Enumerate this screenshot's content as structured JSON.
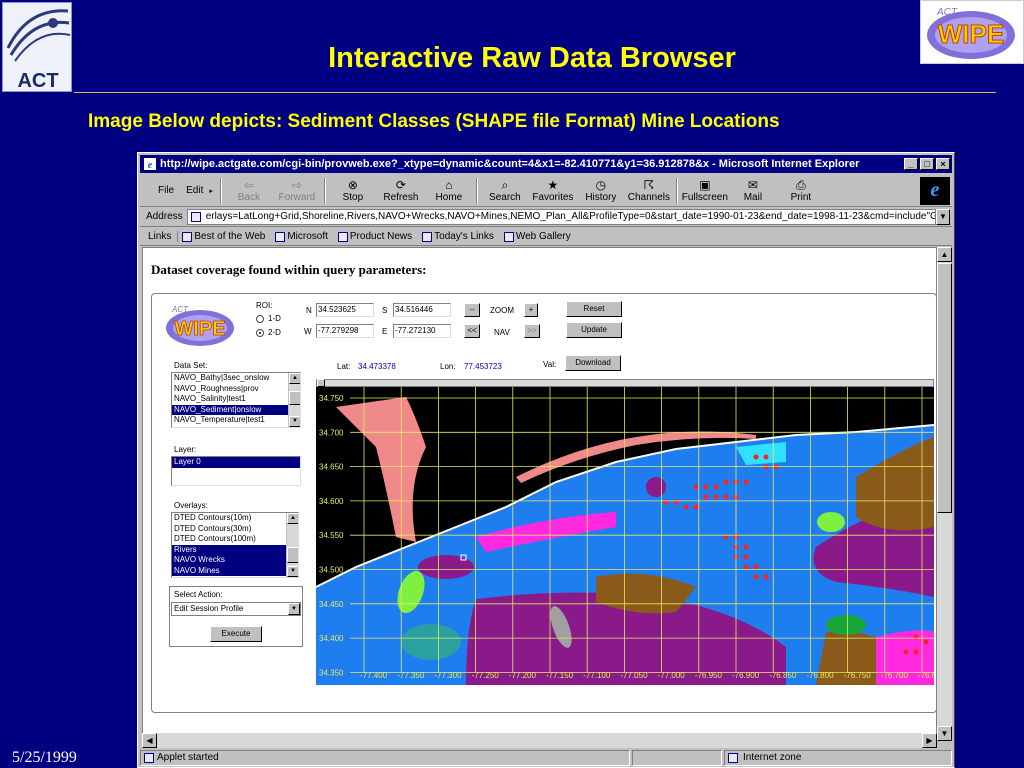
{
  "slide": {
    "title": "Interactive Raw Data Browser",
    "subtitle": "Image Below depicts: Sediment Classes (SHAPE file Format) Mine Locations",
    "date": "5/25/1999",
    "logo_left": "ACT",
    "logo_right": "WIPE"
  },
  "browser": {
    "title": "http://wipe.actgate.com/cgi-bin/provweb.exe?_xtype=dynamic&count=4&x1=-82.410771&y1=36.912878&x - Microsoft Internet Explorer",
    "menus": [
      "File",
      "Edit"
    ],
    "toolbar": [
      {
        "label": "Back",
        "icon": "back-arrow-icon",
        "glyph": "⇦",
        "enabled": false
      },
      {
        "label": "Forward",
        "icon": "forward-arrow-icon",
        "glyph": "⇨",
        "enabled": false
      },
      {
        "label": "Stop",
        "icon": "stop-icon",
        "glyph": "⊗",
        "enabled": true
      },
      {
        "label": "Refresh",
        "icon": "refresh-icon",
        "glyph": "⟳",
        "enabled": true
      },
      {
        "label": "Home",
        "icon": "home-icon",
        "glyph": "⌂",
        "enabled": true
      },
      {
        "label": "Search",
        "icon": "search-icon",
        "glyph": "⌕",
        "enabled": true
      },
      {
        "label": "Favorites",
        "icon": "favorites-icon",
        "glyph": "★",
        "enabled": true
      },
      {
        "label": "History",
        "icon": "history-icon",
        "glyph": "◷",
        "enabled": true
      },
      {
        "label": "Channels",
        "icon": "channels-icon",
        "glyph": "☈",
        "enabled": true
      },
      {
        "label": "Fullscreen",
        "icon": "fullscreen-icon",
        "glyph": "▣",
        "enabled": true
      },
      {
        "label": "Mail",
        "icon": "mail-icon",
        "glyph": "✉",
        "enabled": true
      },
      {
        "label": "Print",
        "icon": "print-icon",
        "glyph": "⎙",
        "enabled": true
      }
    ],
    "address_label": "Address",
    "address_value": "erlays=LatLong+Grid,Shoreline,Rivers,NAVO+Wrecks,NAVO+Mines,NEMO_Plan_All&ProfileType=0&start_date=1990-01-23&end_date=1998-11-23&cmd=include\"Get_Data.msh\"\\n",
    "links_label": "Links",
    "links": [
      "Best of the Web",
      "Microsoft",
      "Product News",
      "Today's Links",
      "Web Gallery"
    ],
    "status_text": "Applet started",
    "zone_text": "Internet zone"
  },
  "page": {
    "heading": "Dataset coverage found within query parameters:"
  },
  "applet": {
    "logo": "WIPE",
    "roi_label": "ROI:",
    "roi_options": [
      "1-D",
      "2-D"
    ],
    "roi_selected": "2-D",
    "n_label": "N",
    "n_value": "34.523625",
    "s_label": "S",
    "s_value": "34.516446",
    "w_label": "W",
    "w_value": "-77.279298",
    "e_label": "E",
    "e_value": "-77.272130",
    "zoom_label": "ZOOM",
    "nav_label": "NAV",
    "zoom_out": "--",
    "zoom_in": "+",
    "nav_left": "<<",
    "nav_right": ">>",
    "reset": "Reset",
    "update": "Update",
    "lat_label": "Lat:",
    "lat_value": "34.473378",
    "lon_label": "Lon:",
    "lon_value": "77.453723",
    "val_label": "Val:",
    "download": "Download",
    "dataset_label": "Data Set:",
    "datasets": [
      "NAVO_Bathy|3sec_onslow",
      "NAVO_Roughness|prov",
      "NAVO_Salinity|test1",
      "NAVO_Sediment|onslow",
      "NAVO_Temperature|test1"
    ],
    "dataset_selected": 3,
    "layer_label": "Layer:",
    "layers": [
      "Layer 0"
    ],
    "overlays_label": "Overlays:",
    "overlays": [
      "DTED Contours(10m)",
      "DTED Contours(30m)",
      "DTED Contours(100m)",
      "Rivers",
      "NAVO Wrecks",
      "NAVO Mines"
    ],
    "overlays_selected": [
      3,
      4,
      5
    ],
    "action_label": "Select Action:",
    "action_value": "Edit Session Profile",
    "execute": "Execute"
  },
  "map": {
    "lat_ticks": [
      "34.750",
      "34.700",
      "34.650",
      "34.600",
      "34.550",
      "34.500",
      "34.450",
      "34.400",
      "34.350"
    ],
    "lon_ticks": [
      "-77.400",
      "-77.350",
      "-77.300",
      "-77.250",
      "-77.200",
      "-77.150",
      "-77.100",
      "-77.050",
      "-77.000",
      "-76.950",
      "-76.900",
      "-76.850",
      "-76.800",
      "-76.750",
      "-76.700",
      "-76.650"
    ],
    "colors": {
      "ocean": "#1e7ef0",
      "land": "#000000",
      "shore": "#f08a8a",
      "grid": "#e8e860",
      "mine": "#ff2020",
      "purple": "#8a1a8a",
      "brown": "#8a5a1a",
      "magenta": "#ff2ae0",
      "green": "#18a83a",
      "lime": "#80f040",
      "teal": "#2aa0a0",
      "cyan": "#30e0ff",
      "gray": "#a0a0a0"
    }
  }
}
